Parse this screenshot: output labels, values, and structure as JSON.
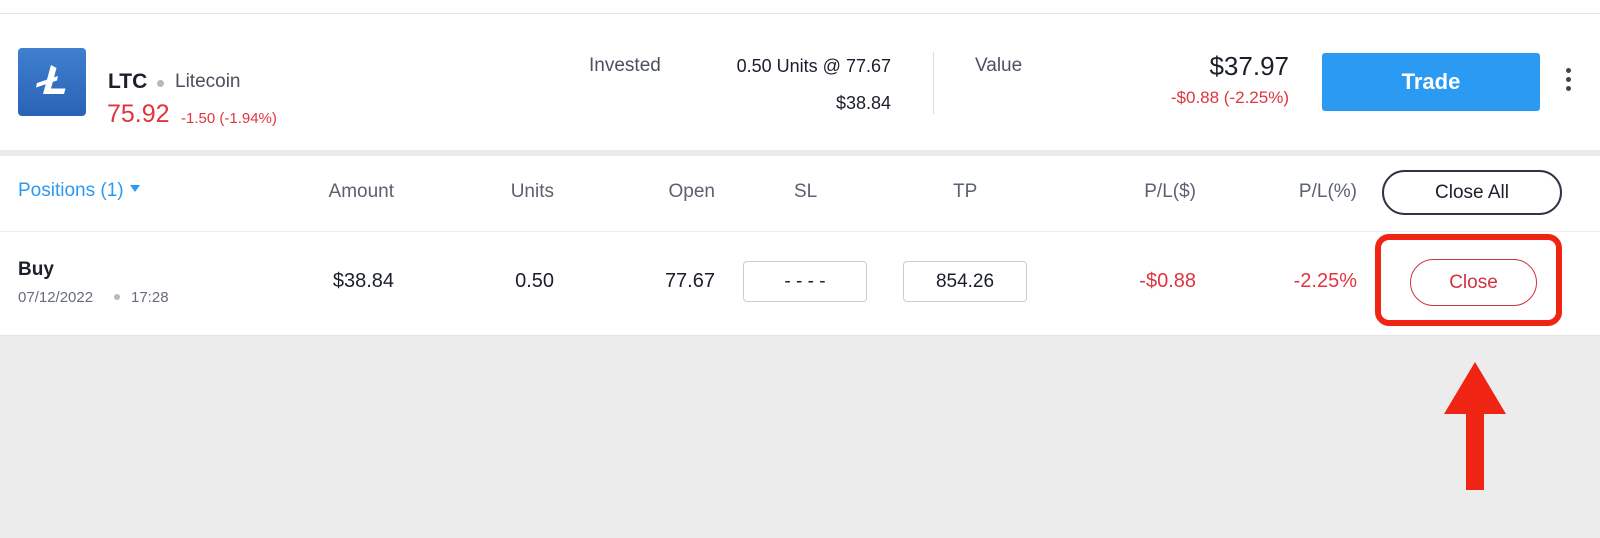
{
  "instrument": {
    "symbol": "LTC",
    "name": "Litecoin",
    "price": "75.92",
    "change": "-1.50 (-1.94%)",
    "logo_icon": "litecoin-logo"
  },
  "investment": {
    "invested_label": "Invested",
    "units_text": "0.50 Units @ 77.67",
    "invested_amount": "$38.84",
    "value_label": "Value",
    "value_amount": "$37.97",
    "value_change": "-$0.88 (-2.25%)"
  },
  "actions": {
    "trade_label": "Trade",
    "more_icon": "kebab-menu"
  },
  "positions": {
    "label": "Positions",
    "count": "(1)",
    "columns": [
      "Amount",
      "Units",
      "Open",
      "SL",
      "TP",
      "P/L($)",
      "P/L(%)"
    ],
    "close_all_label": "Close All",
    "rows": [
      {
        "side": "Buy",
        "date": "07/12/2022",
        "time": "17:28",
        "amount": "$38.84",
        "units": "0.50",
        "open": "77.67",
        "sl": "- - - -",
        "tp": "854.26",
        "pl_usd": "-$0.88",
        "pl_pct": "-2.25%",
        "close_label": "Close"
      }
    ]
  },
  "colors": {
    "accent": "#2b9af3",
    "negative": "#e0353f",
    "annotation": "#f02413"
  }
}
